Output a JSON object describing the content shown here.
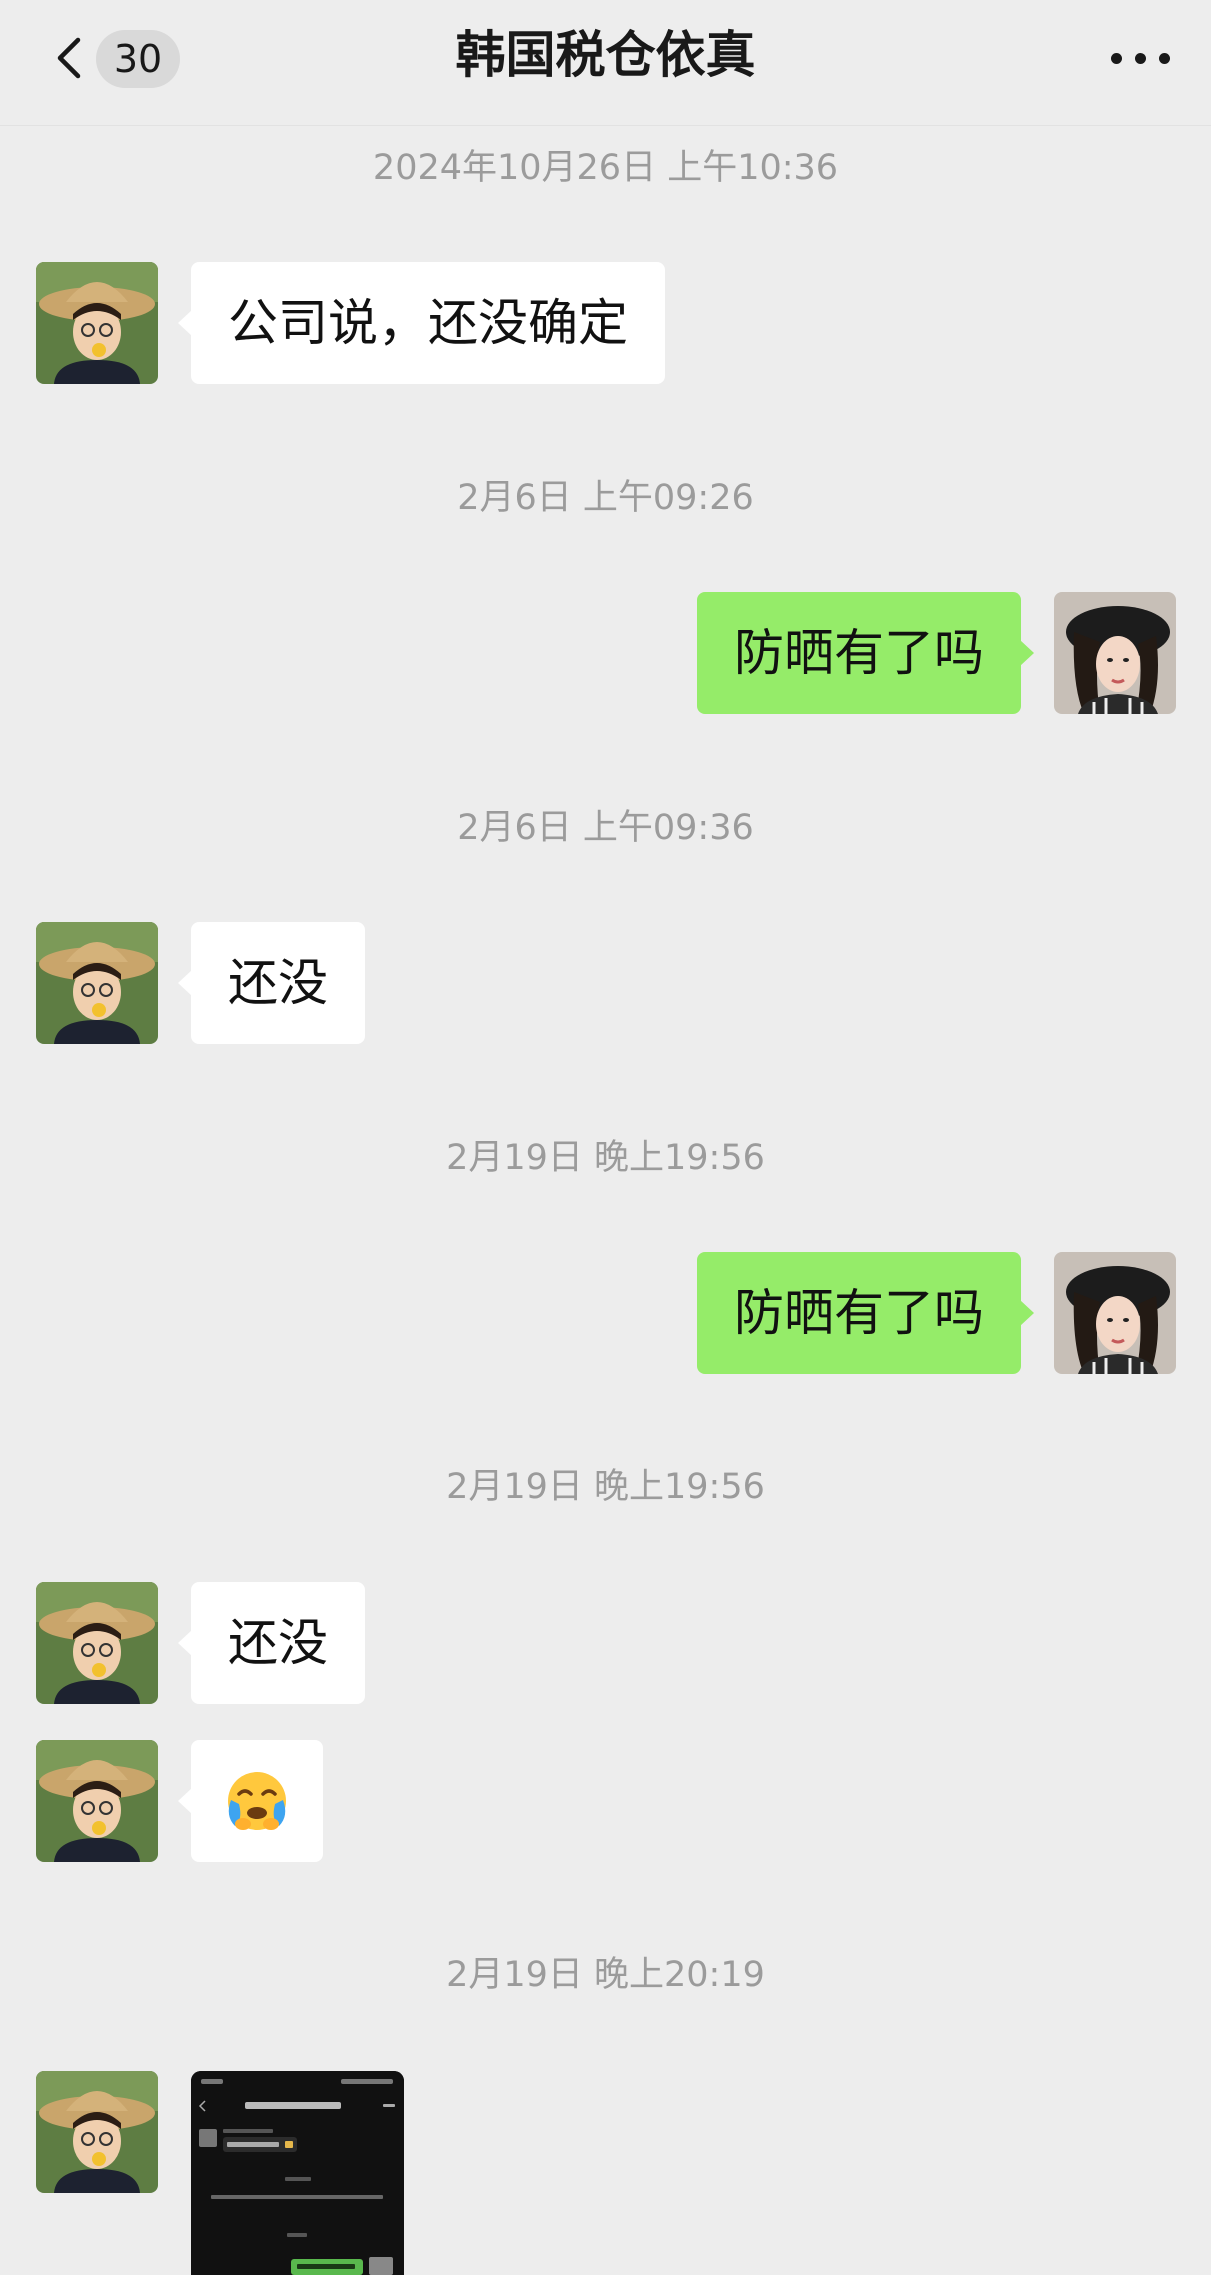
{
  "header": {
    "back_icon": "chevron-left-icon",
    "unread_count": "30",
    "title": "韩国税仓依真",
    "more_icon": "more-horizontal-icon"
  },
  "messages": [
    {
      "type": "timestamp",
      "text": "2024年10月26日 上午10:36"
    },
    {
      "type": "text",
      "side": "in",
      "text": "公司说，还没确定"
    },
    {
      "type": "timestamp",
      "text": "2月6日 上午09:26"
    },
    {
      "type": "text",
      "side": "out",
      "text": "防晒有了吗"
    },
    {
      "type": "timestamp",
      "text": "2月6日 上午09:36"
    },
    {
      "type": "text",
      "side": "in",
      "text": "还没"
    },
    {
      "type": "timestamp",
      "text": "2月19日 晚上19:56"
    },
    {
      "type": "text",
      "side": "out",
      "text": "防晒有了吗"
    },
    {
      "type": "timestamp",
      "text": "2月19日 晚上19:56"
    },
    {
      "type": "text",
      "side": "in",
      "text": "还没"
    },
    {
      "type": "sticker",
      "side": "in",
      "icon": "face-holding-back-tears-emoji"
    },
    {
      "type": "timestamp",
      "text": "2月19日 晚上20:19"
    },
    {
      "type": "image",
      "side": "in",
      "icon": "chat-screenshot-image"
    }
  ],
  "colors": {
    "background": "#ededed",
    "outgoing_bubble": "#95ec69",
    "incoming_bubble": "#ffffff",
    "timestamp_text": "#9b9b9b"
  }
}
